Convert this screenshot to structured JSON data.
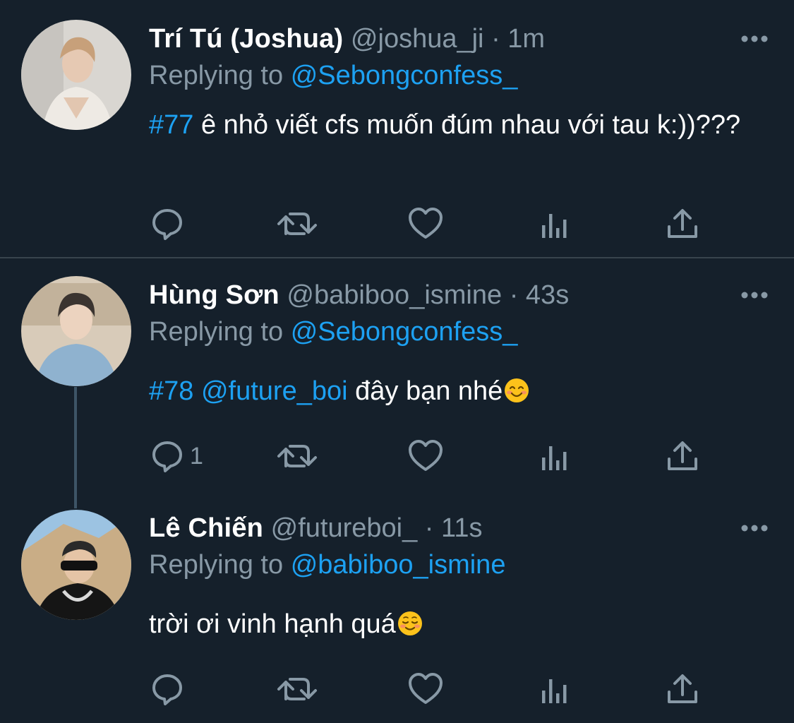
{
  "tweets": [
    {
      "name": "Trí Tú (Joshua)",
      "handle": "@joshua_ji",
      "sep": "·",
      "time": "1m",
      "replying_prefix": "Replying to",
      "replying_to": "@Sebongconfess_",
      "hashtag": "#77",
      "mention": "",
      "text": " ê nhỏ viết cfs muốn đúm nhau với tau k:))???",
      "reply_count": ""
    },
    {
      "name": "Hùng Sơn",
      "handle": "@babiboo_ismine",
      "sep": "·",
      "time": "43s",
      "replying_prefix": "Replying to",
      "replying_to": "@Sebongconfess_",
      "hashtag": "#78",
      "mention": " @future_boi",
      "text": " đây bạn nhé",
      "emoji": "smiling-face-with-smiling-eyes",
      "reply_count": "1"
    },
    {
      "name": "Lê Chiến",
      "handle": "@futureboi_",
      "sep": "·",
      "time": "11s",
      "replying_prefix": "Replying to",
      "replying_to": "@babiboo_ismine",
      "hashtag": "",
      "mention": "",
      "text": "trời ơi vinh hạnh quá",
      "emoji": "smiling-face",
      "reply_count": ""
    }
  ],
  "colors": {
    "background": "#15202b",
    "secondary_text": "#8899a6",
    "link": "#1da1f2",
    "divider": "#38444d",
    "thread_line": "#3d5466"
  },
  "icons": [
    "reply-icon",
    "retweet-icon",
    "like-icon",
    "analytics-icon",
    "share-icon",
    "more-icon"
  ]
}
